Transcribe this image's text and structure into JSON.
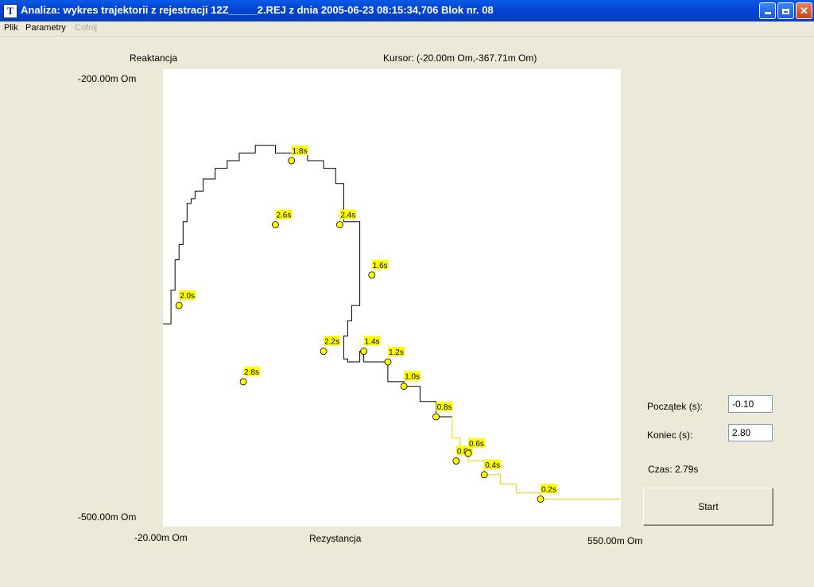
{
  "window": {
    "title": "Analiza: wykres trajektorii z rejestracji 12Z_____2.REJ z dnia 2005-06-23 08:15:34,706 Blok nr.  08",
    "icon_letter": "T"
  },
  "menu": {
    "items": [
      {
        "label": "Plik",
        "enabled": true
      },
      {
        "label": "Parametry",
        "enabled": true
      },
      {
        "label": "Cofnij",
        "enabled": false
      }
    ]
  },
  "plot": {
    "y_axis_title": "Reaktancja",
    "x_axis_title": "Rezystancja",
    "cursor_readout": "Kursor: (-20.00m Om,-367.71m Om)",
    "y_max_label": "-200.00m Om",
    "y_min_label": "-500.00m Om",
    "x_min_label": "-20.00m Om",
    "x_max_label": "550.00m Om"
  },
  "chart_data": {
    "type": "line",
    "xlabel": "Rezystancja",
    "ylabel": "Reaktancja",
    "xlim": [
      -20,
      550
    ],
    "ylim": [
      -500,
      -200
    ],
    "colors": {
      "black_trace": "#000000",
      "yellow_trace": "#e8d200",
      "marker_fill": "#ffff00"
    },
    "series": [
      {
        "points": [
          [
            -20,
            -367
          ],
          [
            -10,
            -367
          ],
          [
            -10,
            -350
          ],
          [
            -10,
            -345
          ],
          [
            -5,
            -345
          ],
          [
            -5,
            -335
          ],
          [
            -5,
            -325
          ],
          [
            0,
            -325
          ],
          [
            0,
            -315
          ],
          [
            5,
            -315
          ],
          [
            5,
            -300
          ],
          [
            10,
            -300
          ],
          [
            10,
            -288
          ],
          [
            15,
            -288
          ],
          [
            15,
            -285
          ],
          [
            20,
            -285
          ],
          [
            20,
            -280
          ],
          [
            30,
            -280
          ],
          [
            30,
            -272
          ],
          [
            45,
            -272
          ],
          [
            45,
            -265
          ],
          [
            60,
            -265
          ],
          [
            60,
            -260
          ],
          [
            75,
            -260
          ],
          [
            75,
            -255
          ],
          [
            95,
            -255
          ],
          [
            95,
            -250
          ],
          [
            120,
            -250
          ],
          [
            120,
            -255
          ],
          [
            160,
            -255
          ],
          [
            160,
            -260
          ],
          [
            180,
            -260
          ],
          [
            180,
            -265
          ],
          [
            195,
            -265
          ],
          [
            195,
            -275
          ],
          [
            205,
            -275
          ],
          [
            205,
            -300
          ],
          [
            225,
            -300
          ],
          [
            225,
            -320
          ],
          [
            225,
            -345
          ],
          [
            225,
            -355
          ],
          [
            215,
            -355
          ],
          [
            215,
            -365
          ],
          [
            210,
            -365
          ],
          [
            210,
            -375
          ],
          [
            205,
            -375
          ],
          [
            205,
            -390
          ],
          [
            210,
            -390
          ],
          [
            210,
            -392
          ],
          [
            225,
            -392
          ],
          [
            225,
            -385
          ],
          [
            230,
            -385
          ],
          [
            230,
            -392
          ],
          [
            260,
            -392
          ],
          [
            260,
            -405
          ],
          [
            280,
            -405
          ],
          [
            280,
            -408
          ],
          [
            300,
            -408
          ],
          [
            300,
            -418
          ],
          [
            320,
            -418
          ],
          [
            320,
            -428
          ],
          [
            340,
            -428
          ],
          [
            340,
            -442
          ],
          [
            350,
            -442
          ],
          [
            350,
            -452
          ],
          [
            360,
            -452
          ],
          [
            360,
            -457
          ],
          [
            380,
            -457
          ],
          [
            380,
            -466
          ],
          [
            400,
            -466
          ],
          [
            400,
            -472
          ],
          [
            420,
            -472
          ],
          [
            420,
            -478
          ],
          [
            450,
            -478
          ],
          [
            450,
            -482
          ],
          [
            470,
            -482
          ],
          [
            470,
            -482
          ],
          [
            520,
            -482
          ],
          [
            520,
            -482
          ],
          [
            540,
            -482
          ],
          [
            540,
            -482
          ],
          [
            555,
            -482
          ],
          [
            555,
            -500
          ]
        ],
        "markers": [
          {
            "x": 345,
            "y": -457,
            "label": "0.0s"
          },
          {
            "x": 450,
            "y": -482,
            "label": "0.2s"
          },
          {
            "x": 380,
            "y": -466,
            "label": "0.4s"
          },
          {
            "x": 360,
            "y": -452,
            "label": "0.6s"
          },
          {
            "x": 320,
            "y": -428,
            "label": "0.8s"
          },
          {
            "x": 280,
            "y": -408,
            "label": "1.0s"
          },
          {
            "x": 260,
            "y": -392,
            "label": "1.2s"
          },
          {
            "x": 230,
            "y": -385,
            "label": "1.4s"
          },
          {
            "x": 240,
            "y": -335,
            "label": "1.6s"
          },
          {
            "x": 140,
            "y": -260,
            "label": "1.8s"
          },
          {
            "x": 0,
            "y": -355,
            "label": "2.0s"
          },
          {
            "x": 180,
            "y": -385,
            "label": "2.2s"
          },
          {
            "x": 200,
            "y": -302,
            "label": "2.4s"
          },
          {
            "x": 120,
            "y": -302,
            "label": "2.6s"
          },
          {
            "x": 80,
            "y": -405,
            "label": "2.8s"
          }
        ]
      }
    ]
  },
  "controls": {
    "start_label": "Początek (s):",
    "start_value": "-0.10",
    "end_label": "Koniec (s):",
    "end_value": "2.80",
    "time_readout": "Czas: 2.79s",
    "start_button": "Start"
  }
}
